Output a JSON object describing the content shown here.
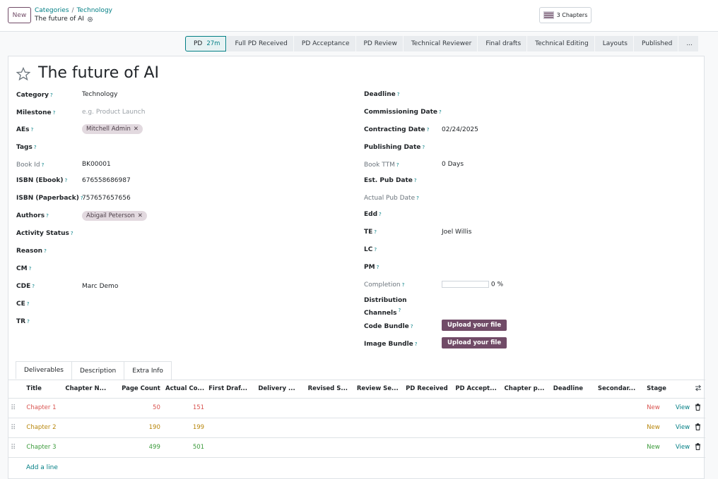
{
  "header": {
    "new_label": "New",
    "breadcrumb_root": "Categories",
    "breadcrumb_sep": "/",
    "breadcrumb_parent": "Technology",
    "record_title": "The future of AI",
    "chapters_button": "3 Chapters"
  },
  "statusbar": {
    "stages": [
      {
        "label": "PD",
        "duration": "27m"
      },
      {
        "label": "Full PD Received"
      },
      {
        "label": "PD Acceptance"
      },
      {
        "label": "PD Review"
      },
      {
        "label": "Technical Reviewer"
      },
      {
        "label": "Final drafts"
      },
      {
        "label": "Technical Editing"
      },
      {
        "label": "Layouts"
      },
      {
        "label": "Published"
      },
      {
        "label": "..."
      }
    ]
  },
  "form": {
    "name": "The future of AI",
    "left": {
      "category": {
        "label": "Category",
        "value": "Technology"
      },
      "milestone": {
        "label": "Milestone",
        "placeholder": "e.g. Product Launch"
      },
      "aes": {
        "label": "AEs",
        "tag": "Mitchell Admin"
      },
      "tags": {
        "label": "Tags"
      },
      "book_id": {
        "label": "Book Id",
        "value": "BK00001"
      },
      "isbn_ebook": {
        "label": "ISBN (Ebook)",
        "value": "676558686987"
      },
      "isbn_paperback": {
        "label": "ISBN (Paperback)",
        "value": "757657657656"
      },
      "authors": {
        "label": "Authors",
        "tag": "Abigail Peterson"
      },
      "activity_status": {
        "label": "Activity Status"
      },
      "reason": {
        "label": "Reason"
      },
      "cm": {
        "label": "CM"
      },
      "cde": {
        "label": "CDE",
        "value": "Marc Demo"
      },
      "ce": {
        "label": "CE"
      },
      "tr": {
        "label": "TR"
      }
    },
    "right": {
      "deadline": {
        "label": "Deadline"
      },
      "commissioning_date": {
        "label": "Commissioning Date"
      },
      "contracting_date": {
        "label": "Contracting Date",
        "value": "02/24/2025"
      },
      "publishing_date": {
        "label": "Publishing Date"
      },
      "book_ttm": {
        "label": "Book TTM",
        "value": "0 Days"
      },
      "est_pub_date": {
        "label": "Est. Pub Date"
      },
      "actual_pub_date": {
        "label": "Actual Pub Date"
      },
      "edd": {
        "label": "Edd"
      },
      "te": {
        "label": "TE",
        "value": "Joel Willis"
      },
      "lc": {
        "label": "LC"
      },
      "pm": {
        "label": "PM"
      },
      "completion": {
        "label": "Completion",
        "value": "0 %",
        "fraction": 0
      },
      "distribution_line1": "Distribution",
      "distribution_line2": "Channels",
      "code_bundle": {
        "label": "Code Bundle",
        "button": "Upload your file"
      },
      "image_bundle": {
        "label": "Image Bundle",
        "button": "Upload your file"
      }
    }
  },
  "tabs": [
    "Deliverables",
    "Description",
    "Extra Info"
  ],
  "table": {
    "columns": [
      "Title",
      "Chapter N...",
      "Page Count",
      "Actual Co...",
      "First Draf...",
      "Delivery ...",
      "Revised S...",
      "Review Se...",
      "PD Received",
      "PD Accept...",
      "Chapter p...",
      "Deadline",
      "Secondar...",
      "Stage"
    ],
    "rows": [
      {
        "title": "Chapter 1",
        "page_count": "50",
        "actual": "151",
        "stage": "New",
        "view": "View",
        "color": "#d9534f"
      },
      {
        "title": "Chapter 2",
        "page_count": "190",
        "actual": "199",
        "stage": "New",
        "view": "View",
        "color": "#b8860b"
      },
      {
        "title": "Chapter 3",
        "page_count": "499",
        "actual": "501",
        "stage": "New",
        "view": "View",
        "color": "#3a9a3a"
      }
    ],
    "add_line": "Add a line"
  },
  "colors": {
    "brand": "#714b67",
    "link": "#017e84"
  }
}
